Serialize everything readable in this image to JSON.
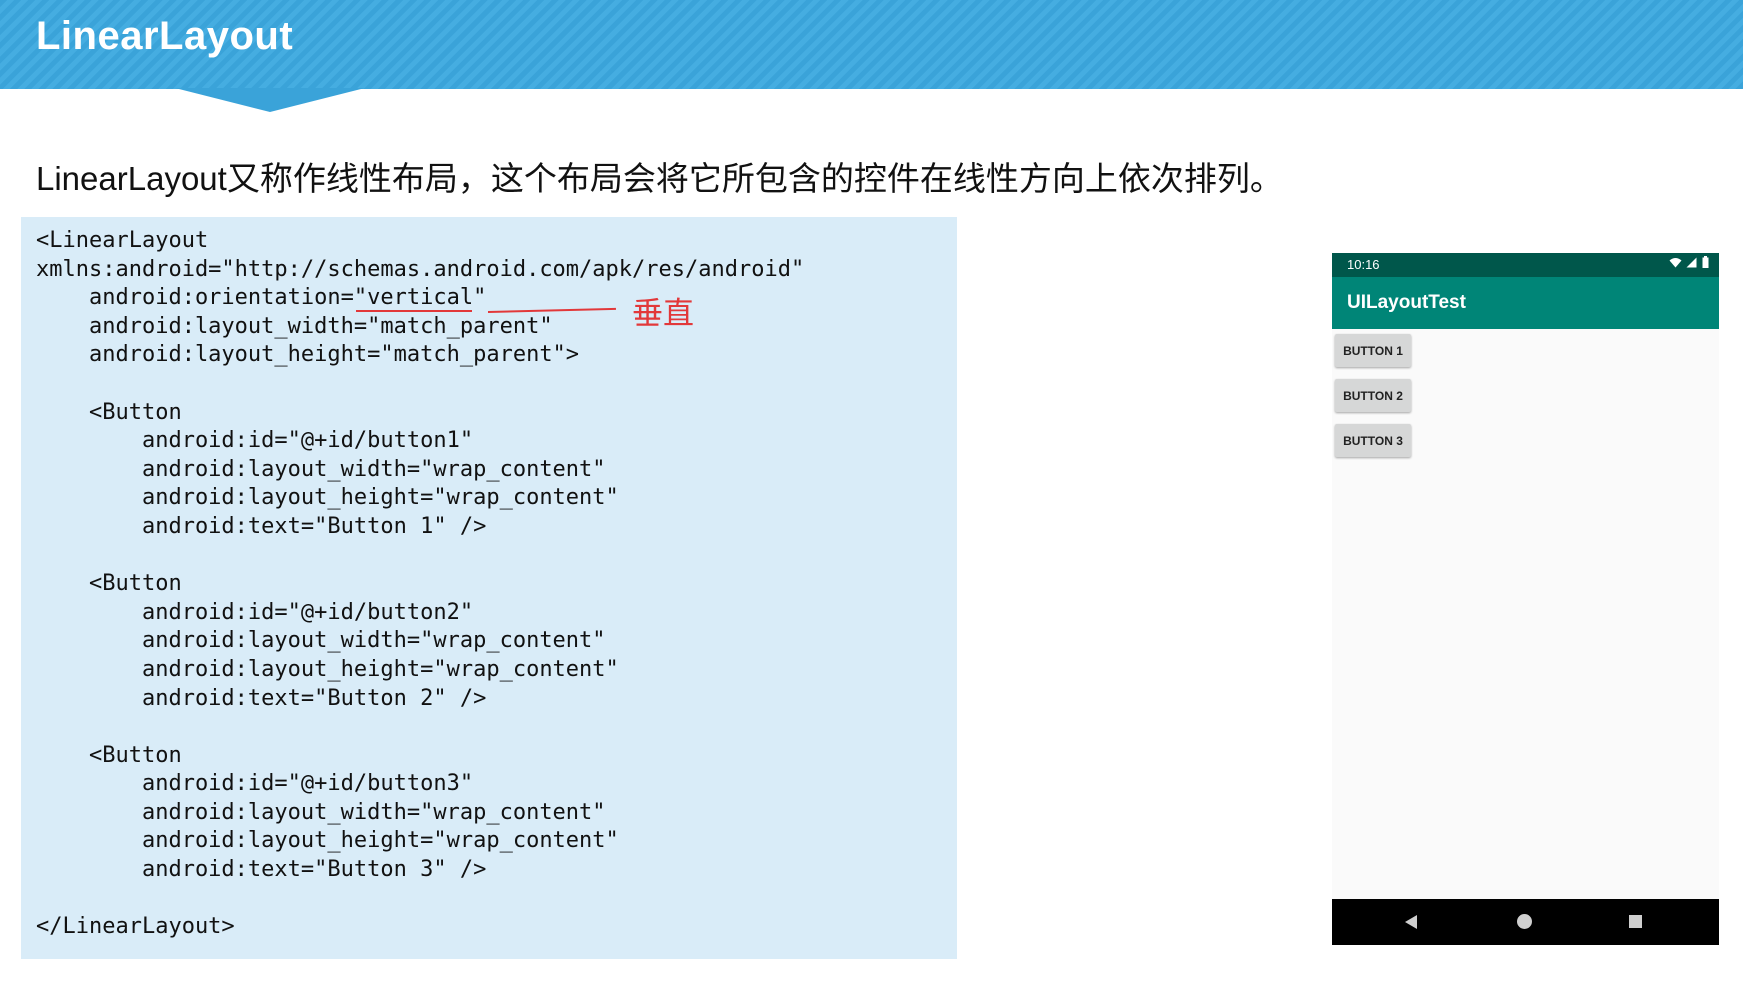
{
  "slide": {
    "title": "LinearLayout",
    "intro_latin": "LinearLayout",
    "intro_cn": "又称作线性布局，这个布局会将它所包含的控件在线性方向上依次排列。"
  },
  "code": {
    "lines": [
      "<LinearLayout",
      "xmlns:android=\"http://schemas.android.com/apk/res/android\"",
      "    android:orientation=\"vertical\"",
      "    android:layout_width=\"match_parent\"",
      "    android:layout_height=\"match_parent\">",
      "",
      "    <Button",
      "        android:id=\"@+id/button1\"",
      "        android:layout_width=\"wrap_content\"",
      "        android:layout_height=\"wrap_content\"",
      "        android:text=\"Button 1\" />",
      "",
      "    <Button",
      "        android:id=\"@+id/button2\"",
      "        android:layout_width=\"wrap_content\"",
      "        android:layout_height=\"wrap_content\"",
      "        android:text=\"Button 2\" />",
      "",
      "    <Button",
      "        android:id=\"@+id/button3\"",
      "        android:layout_width=\"wrap_content\"",
      "        android:layout_height=\"wrap_content\"",
      "        android:text=\"Button 3\" />",
      "",
      "</LinearLayout>"
    ],
    "annotation": "垂直"
  },
  "phone": {
    "status_time": "10:16",
    "status_icons": [
      "wifi-icon",
      "signal-icon",
      "battery-icon"
    ],
    "app_title": "UILayoutTest",
    "buttons": [
      "BUTTON 1",
      "BUTTON 2",
      "BUTTON 3"
    ],
    "nav": [
      "back-icon",
      "home-icon",
      "recents-icon"
    ]
  },
  "colors": {
    "header": "#3aa3d9",
    "code_bg": "#d9ecf8",
    "annotation": "#e2383a",
    "status_bar": "#00574b",
    "app_bar": "#008577"
  }
}
